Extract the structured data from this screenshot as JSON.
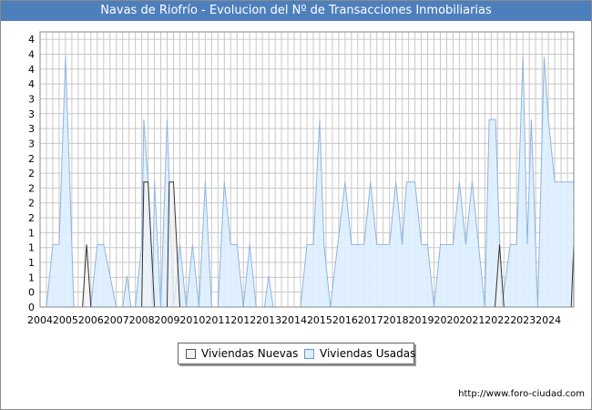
{
  "header": {
    "title": "Navas de Riofrío - Evolucion del Nº de Transacciones Inmobiliarias"
  },
  "footer": {
    "source": "http://www.foro-ciudad.com"
  },
  "colors": {
    "title_bg": "#4e7fbd",
    "nuevas_fill": "#f2f2f2",
    "nuevas_line": "#333333",
    "usadas_fill": "#ddeeff",
    "usadas_line": "#8fb4e0",
    "grid": "#c8c8c8"
  },
  "chart_data": {
    "type": "area",
    "title": "Navas de Riofrío - Evolucion del Nº de Transacciones Inmobiliarias",
    "xlabel": "",
    "ylabel": "",
    "x_ticks": [
      "2004",
      "2005",
      "2006",
      "2007",
      "2008",
      "2009",
      "2010",
      "2011",
      "2012",
      "2013",
      "2014",
      "2015",
      "2016",
      "2017",
      "2018",
      "2019",
      "2020",
      "2021",
      "2022",
      "2023",
      "2024"
    ],
    "y_tick_labels": [
      "0",
      "0",
      "1",
      "1",
      "1",
      "1",
      "2",
      "2",
      "2",
      "2",
      "2",
      "3",
      "3",
      "3",
      "3",
      "4",
      "4",
      "4",
      "4"
    ],
    "ylim": [
      0,
      4.4
    ],
    "x_range": [
      2004,
      2025
    ],
    "grid": true,
    "legend_position": "bottom",
    "series": [
      {
        "name": "Viviendas Nuevas",
        "points": [
          [
            2004,
            0
          ],
          [
            2005.67,
            0
          ],
          [
            2005.83,
            1
          ],
          [
            2006.0,
            0
          ],
          [
            2008.0,
            0
          ],
          [
            2008.08,
            2
          ],
          [
            2008.25,
            2
          ],
          [
            2008.5,
            0
          ],
          [
            2009.0,
            0
          ],
          [
            2009.08,
            2
          ],
          [
            2009.25,
            2
          ],
          [
            2009.5,
            0
          ],
          [
            2021.9,
            0
          ],
          [
            2022.08,
            1
          ],
          [
            2022.25,
            0
          ],
          [
            2024.9,
            0
          ],
          [
            2025,
            1
          ]
        ]
      },
      {
        "name": "Viviendas Usadas",
        "points": [
          [
            2004,
            0
          ],
          [
            2004.25,
            0
          ],
          [
            2004.5,
            1
          ],
          [
            2004.75,
            1
          ],
          [
            2005.0,
            4
          ],
          [
            2005.17,
            2
          ],
          [
            2005.33,
            0
          ],
          [
            2006.0,
            0
          ],
          [
            2006.25,
            1
          ],
          [
            2006.5,
            1
          ],
          [
            2007.0,
            0
          ],
          [
            2007.25,
            0
          ],
          [
            2007.42,
            0.5
          ],
          [
            2007.58,
            0
          ],
          [
            2007.75,
            0
          ],
          [
            2008.0,
            1
          ],
          [
            2008.08,
            3
          ],
          [
            2008.25,
            2
          ],
          [
            2008.42,
            0
          ],
          [
            2008.5,
            2
          ],
          [
            2008.75,
            0
          ],
          [
            2009.0,
            3
          ],
          [
            2009.25,
            0
          ],
          [
            2009.5,
            1
          ],
          [
            2009.75,
            0
          ],
          [
            2010.0,
            1
          ],
          [
            2010.25,
            0
          ],
          [
            2010.5,
            2
          ],
          [
            2010.75,
            0
          ],
          [
            2011.0,
            0
          ],
          [
            2011.25,
            2
          ],
          [
            2011.5,
            1
          ],
          [
            2011.75,
            1
          ],
          [
            2012.0,
            0
          ],
          [
            2012.25,
            1
          ],
          [
            2012.5,
            0
          ],
          [
            2012.83,
            0
          ],
          [
            2013.0,
            0.5
          ],
          [
            2013.17,
            0
          ],
          [
            2013.5,
            0
          ],
          [
            2014.25,
            0
          ],
          [
            2014.5,
            1
          ],
          [
            2014.75,
            1
          ],
          [
            2015.0,
            3
          ],
          [
            2015.17,
            1
          ],
          [
            2015.42,
            0
          ],
          [
            2016.0,
            2
          ],
          [
            2016.25,
            1
          ],
          [
            2016.75,
            1
          ],
          [
            2017.0,
            2
          ],
          [
            2017.25,
            1
          ],
          [
            2017.75,
            1
          ],
          [
            2018.0,
            2
          ],
          [
            2018.25,
            1
          ],
          [
            2018.42,
            2
          ],
          [
            2018.75,
            2
          ],
          [
            2019.0,
            1
          ],
          [
            2019.25,
            1
          ],
          [
            2019.5,
            0
          ],
          [
            2019.75,
            1
          ],
          [
            2020.25,
            1
          ],
          [
            2020.5,
            2
          ],
          [
            2020.75,
            1
          ],
          [
            2021.0,
            2
          ],
          [
            2021.25,
            1
          ],
          [
            2021.5,
            0
          ],
          [
            2021.67,
            3
          ],
          [
            2021.92,
            3
          ],
          [
            2022.17,
            0
          ],
          [
            2022.5,
            1
          ],
          [
            2022.75,
            1
          ],
          [
            2023.0,
            4
          ],
          [
            2023.17,
            1
          ],
          [
            2023.33,
            3
          ],
          [
            2023.58,
            0
          ],
          [
            2023.83,
            4
          ],
          [
            2024.0,
            3
          ],
          [
            2024.25,
            2
          ],
          [
            2024.42,
            2
          ],
          [
            2025,
            2
          ]
        ]
      }
    ]
  },
  "legend": {
    "items": [
      {
        "label": "Viviendas Nuevas"
      },
      {
        "label": "Viviendas Usadas"
      }
    ]
  }
}
